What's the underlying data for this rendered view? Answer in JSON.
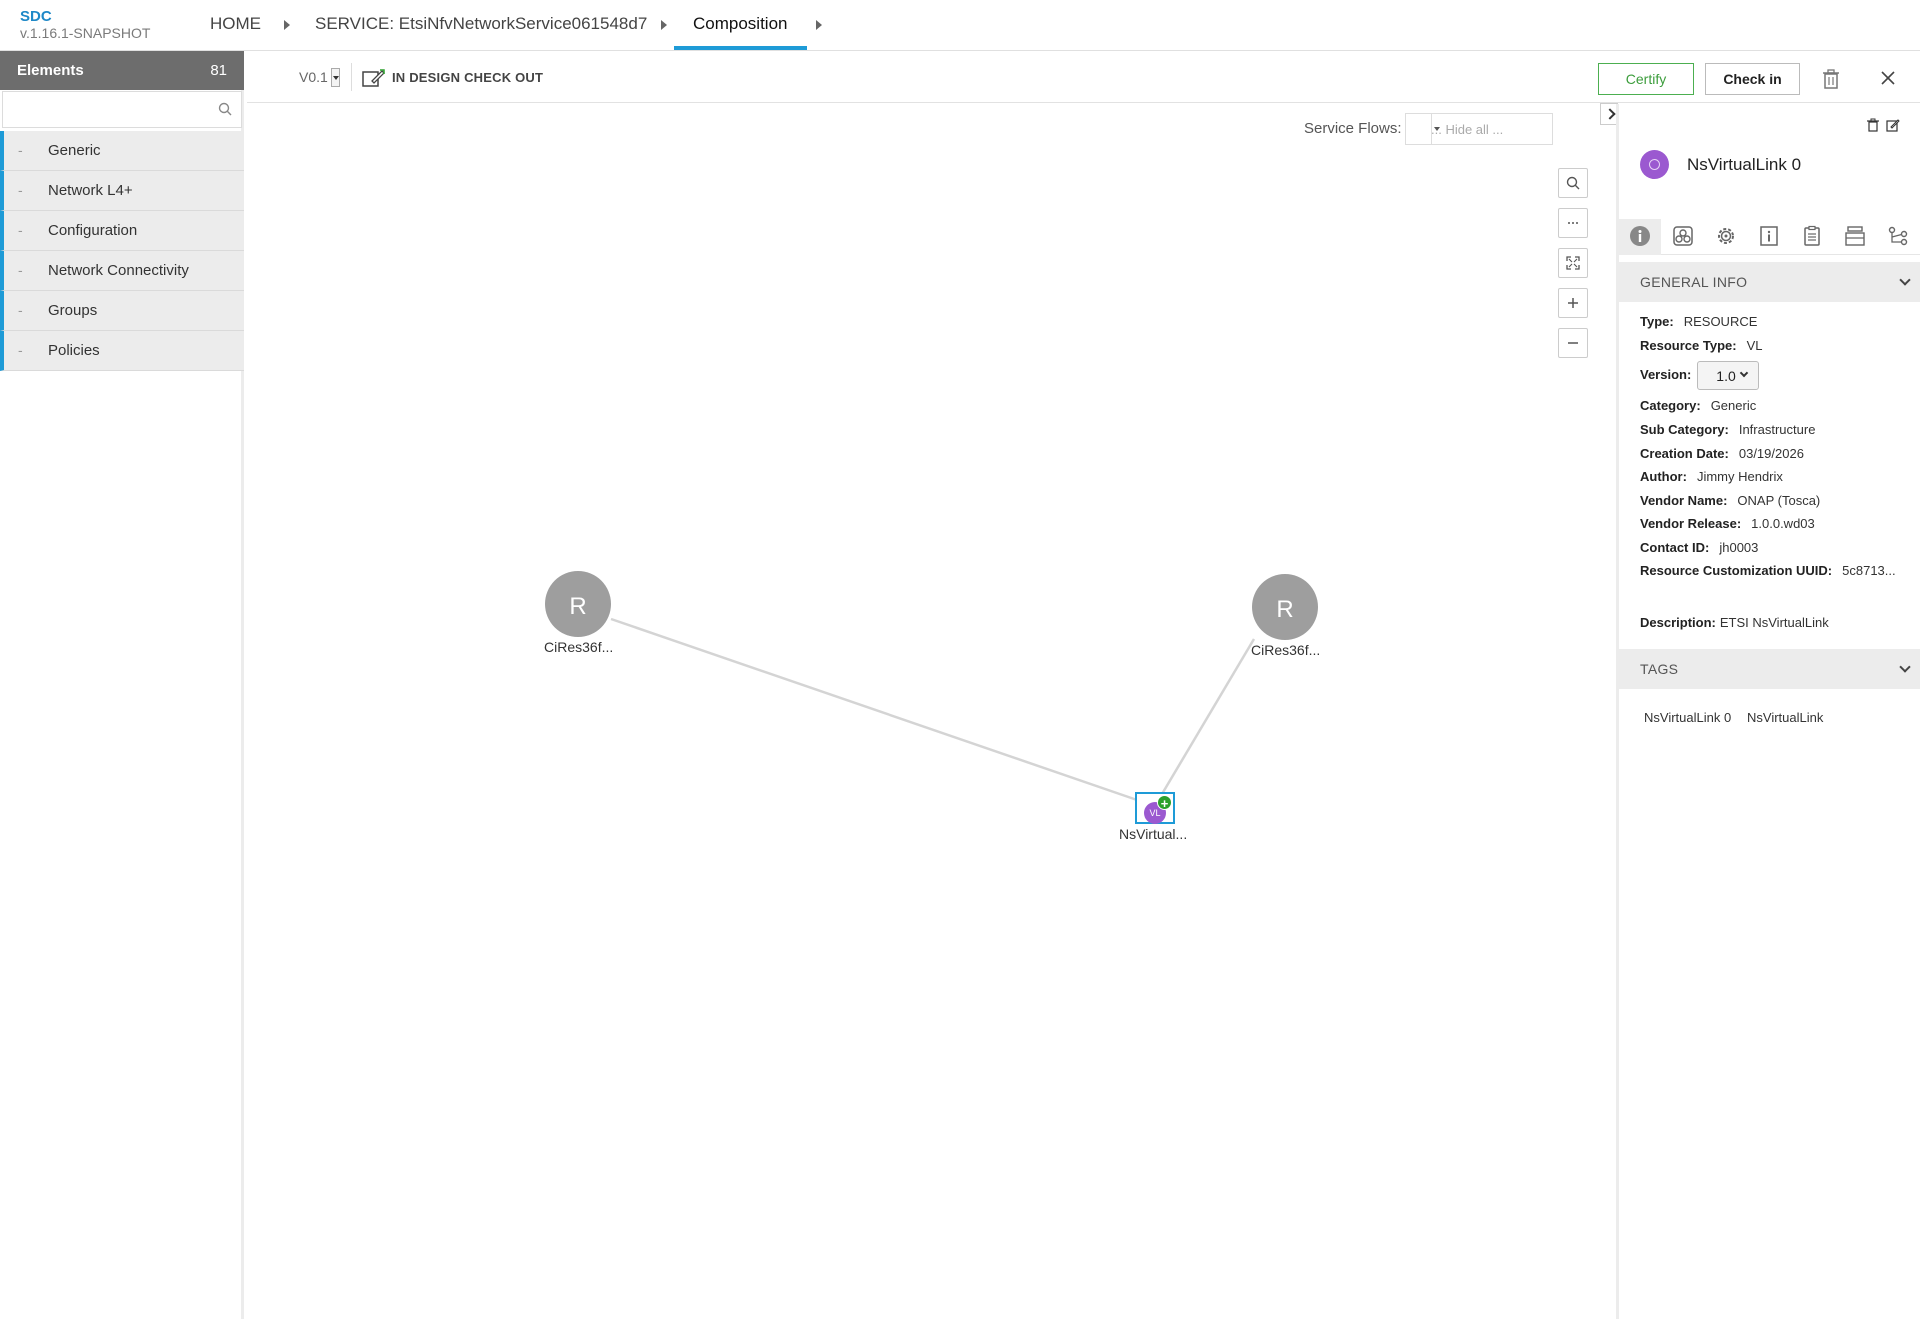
{
  "header": {
    "brand": "SDC",
    "version": "v.1.16.1-SNAPSHOT",
    "breadcrumbs": [
      {
        "label": "HOME"
      },
      {
        "label": "SERVICE: EtsiNfvNetworkService061548d7"
      },
      {
        "label": "Composition"
      }
    ]
  },
  "palette": {
    "title": "Elements",
    "count": "81",
    "search_placeholder": "",
    "groups": [
      {
        "dash": "-",
        "label": "Generic"
      },
      {
        "dash": "-",
        "label": "Network L4+"
      },
      {
        "dash": "-",
        "label": "Configuration"
      },
      {
        "dash": "-",
        "label": "Network Connectivity"
      },
      {
        "dash": "-",
        "label": "Groups"
      },
      {
        "dash": "-",
        "label": "Policies"
      }
    ]
  },
  "toolbar": {
    "version": "V0.1",
    "status": "IN DESIGN CHECK OUT",
    "certify_label": "Certify",
    "checkin_label": "Check in"
  },
  "canvas": {
    "service_flows_label": "Service Flows:",
    "service_flows_value": "... Hide all ...",
    "nodes": [
      {
        "letter": "R",
        "label": "CiRes36f..."
      },
      {
        "letter": "R",
        "label": "CiRes36f..."
      },
      {
        "badge": "VL",
        "plus": "+",
        "label": "NsVirtual..."
      }
    ]
  },
  "details": {
    "title": "NsVirtualLink 0",
    "general_info_title": "GENERAL INFO",
    "fields": {
      "type": {
        "label": "Type:",
        "value": "RESOURCE"
      },
      "resource_type": {
        "label": "Resource Type:",
        "value": "VL"
      },
      "version": {
        "label": "Version:",
        "value": "1.0"
      },
      "category": {
        "label": "Category:",
        "value": "Generic"
      },
      "sub_category": {
        "label": "Sub Category:",
        "value": "Infrastructure"
      },
      "creation_date": {
        "label": "Creation Date:",
        "value": "03/19/2026"
      },
      "author": {
        "label": "Author:",
        "value": "Jimmy Hendrix"
      },
      "vendor_name": {
        "label": "Vendor Name:",
        "value": "ONAP (Tosca)"
      },
      "vendor_release": {
        "label": "Vendor Release:",
        "value": "1.0.0.wd03"
      },
      "contact_id": {
        "label": "Contact ID:",
        "value": "jh0003"
      },
      "customization_uuid": {
        "label": "Resource Customization UUID:",
        "value": "5c8713..."
      },
      "description": {
        "label": "Description:",
        "value": "ETSI NsVirtualLink"
      }
    },
    "tags_title": "TAGS",
    "tags": [
      "NsVirtualLink 0",
      "NsVirtualLink"
    ]
  },
  "colors": {
    "accent": "#1e9bd7",
    "certify": "#4caf50",
    "vl_node": "#9b59d0",
    "resource_node": "#9e9e9e",
    "plus_badge": "#2ca02c"
  }
}
